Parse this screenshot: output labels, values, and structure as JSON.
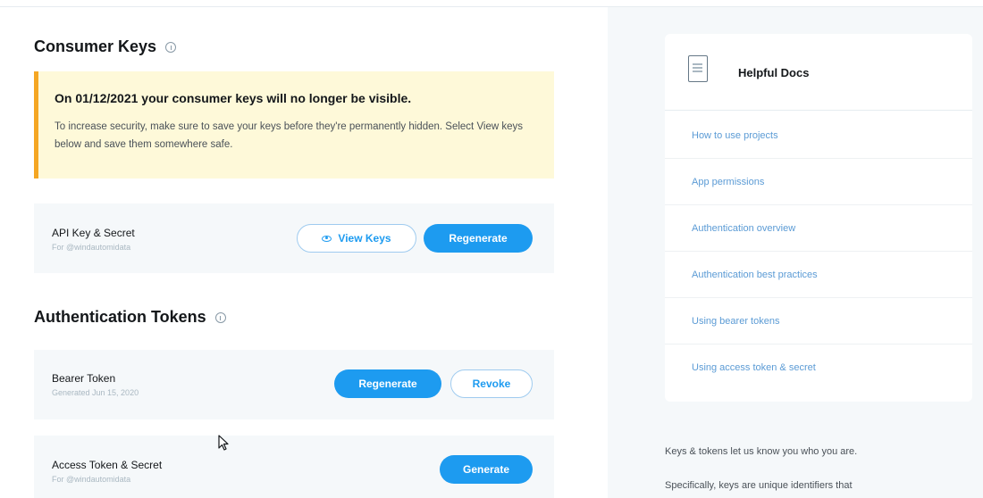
{
  "consumer_keys": {
    "title": "Consumer Keys",
    "notice": {
      "title": "On 01/12/2021 your consumer keys will no longer be visible.",
      "body": "To increase security, make sure to save your keys before they're permanently hidden. Select View keys below and save them somewhere safe."
    },
    "api_key": {
      "title": "API Key & Secret",
      "subtitle": "For @windautomidata",
      "view_keys_label": "View Keys",
      "regenerate_label": "Regenerate"
    }
  },
  "auth_tokens": {
    "title": "Authentication Tokens",
    "bearer": {
      "title": "Bearer Token",
      "subtitle": "Generated Jun 15, 2020",
      "regenerate_label": "Regenerate",
      "revoke_label": "Revoke"
    },
    "access": {
      "title": "Access Token & Secret",
      "subtitle": "For @windautomidata",
      "generate_label": "Generate"
    }
  },
  "docs": {
    "title": "Helpful Docs",
    "links": [
      "How to use projects",
      "App permissions",
      "Authentication overview",
      "Authentication best practices",
      "Using bearer tokens",
      "Using access token & secret"
    ]
  },
  "sidebar_text": {
    "line1": "Keys & tokens let us know you who you are.",
    "line2": "Specifically, keys are unique identifiers that"
  },
  "colors": {
    "accent": "#1d9bf0",
    "notice_bg": "#fef9d9",
    "notice_border": "#f5a623",
    "panel_bg": "#f5f8fa",
    "link": "#5b9bd5"
  }
}
